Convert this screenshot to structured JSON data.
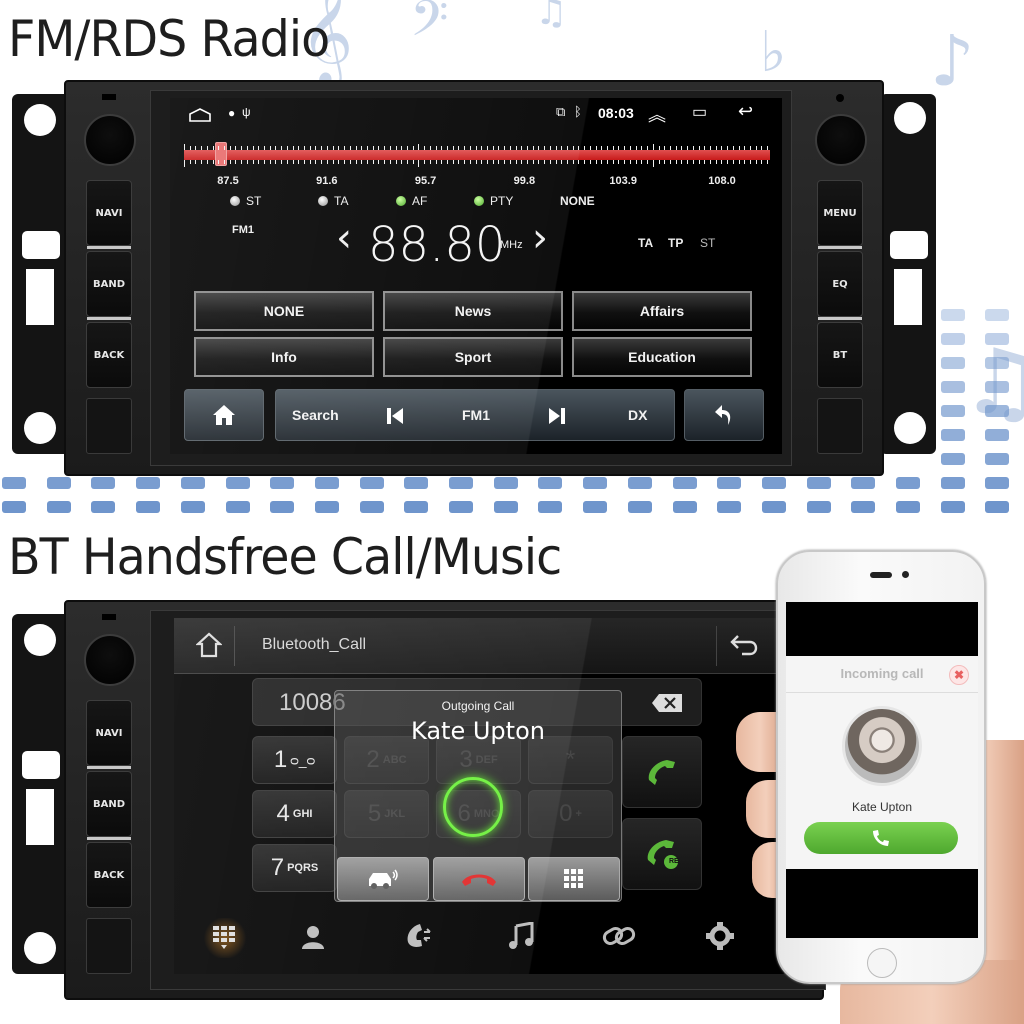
{
  "sections": {
    "radio_heading": "FM/RDS Radio",
    "bt_heading": "BT Handsfree Call/Music"
  },
  "hardware_buttons": {
    "left": [
      "NAVI",
      "BAND",
      "BACK"
    ],
    "right": [
      "MENU",
      "EQ",
      "BT"
    ]
  },
  "radio": {
    "status_bar": {
      "time": "08:03",
      "icons": [
        "home-outline-icon",
        "location-icon",
        "usb-icon",
        "cast-icon",
        "bluetooth-icon",
        "expand-up-icon",
        "recent-apps-icon",
        "back-arrow-icon"
      ]
    },
    "tuner": {
      "min_mhz": 87.5,
      "max_mhz": 108.0,
      "current_mhz": 88.8,
      "scale_labels": [
        "87.5",
        "91.6",
        "95.7",
        "99.8",
        "103.9",
        "108.0"
      ]
    },
    "indicators": [
      {
        "label": "ST",
        "active": false
      },
      {
        "label": "TA",
        "active": false
      },
      {
        "label": "AF",
        "active": true
      },
      {
        "label": "PTY",
        "active": true
      }
    ],
    "pty_value": "NONE",
    "band": "FM1",
    "frequency": "88.80",
    "unit": "MHz",
    "flags": [
      "TA",
      "TP",
      "ST"
    ],
    "pty_buttons": [
      "NONE",
      "News",
      "Affairs",
      "Info",
      "Sport",
      "Education"
    ],
    "controls": {
      "search": "Search",
      "band": "FM1",
      "dx": "DX"
    }
  },
  "bluetooth": {
    "title": "Bluetooth_Call",
    "dialed_number": "10086",
    "keypad": [
      {
        "num": "1",
        "sub": "voicemail"
      },
      {
        "num": "2",
        "sub": "ABC"
      },
      {
        "num": "3",
        "sub": "DEF"
      },
      {
        "num": "*",
        "sub": ""
      },
      {
        "num": "4",
        "sub": "GHI"
      },
      {
        "num": "5",
        "sub": "JKL"
      },
      {
        "num": "6",
        "sub": "MNO"
      },
      {
        "num": "0",
        "sub": "+"
      },
      {
        "num": "7",
        "sub": "PQRS"
      }
    ],
    "redial_badge": "RE",
    "popup": {
      "title": "Outgoing Call",
      "contact": "Kate Upton"
    },
    "bottom_nav": [
      "dialpad-icon",
      "contacts-icon",
      "call-log-icon",
      "music-icon",
      "link-icon",
      "settings-icon"
    ]
  },
  "phone": {
    "title": "Incoming call",
    "contact": "Kate Upton"
  },
  "colors": {
    "tuner_red": "#d42a2a",
    "indicator_green": "#3fa41e",
    "call_green": "#5cb83a",
    "hangup_red": "#e02828",
    "eq_blue": "#6f95cc"
  }
}
